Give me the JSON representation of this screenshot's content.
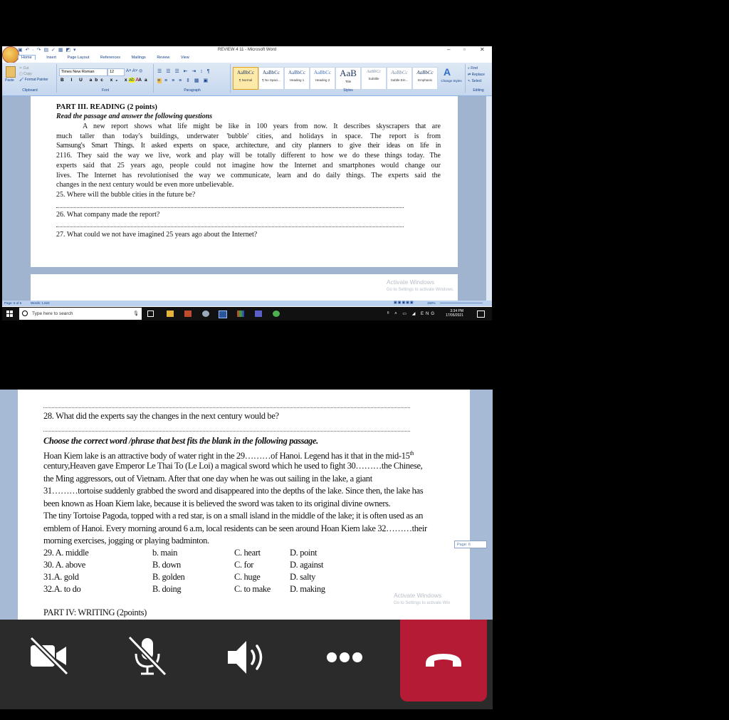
{
  "word_window": {
    "title": "REVIEW 4 11 - Microsoft Word",
    "tabs": [
      "Home",
      "Insert",
      "Page Layout",
      "References",
      "Mailings",
      "Review",
      "View"
    ],
    "clipboard": {
      "paste": "Paste",
      "cut": "Cut",
      "copy": "Copy",
      "format_painter": "Format Painter",
      "label": "Clipboard"
    },
    "font": {
      "name": "Times New Roman",
      "size": "12",
      "label": "Font"
    },
    "paragraph_label": "Paragraph",
    "styles": [
      {
        "sample": "AaBbCc",
        "name": "¶ Normal"
      },
      {
        "sample": "AaBbCc",
        "name": "¶ No Spaci..."
      },
      {
        "sample": "AaBbCc",
        "name": "Heading 1"
      },
      {
        "sample": "AaBbCc",
        "name": "Heading 2"
      },
      {
        "sample": "AaB",
        "name": "Title"
      },
      {
        "sample": "AaBbCc",
        "name": "Subtitle"
      },
      {
        "sample": "AaBbCc",
        "name": "Subtle Em..."
      },
      {
        "sample": "AaBbCc",
        "name": "Emphasis"
      }
    ],
    "styles_label": "Styles",
    "change_styles": "Change Styles",
    "editing": {
      "find": "Find",
      "replace": "Replace",
      "select": "Select",
      "label": "Editing"
    },
    "status": {
      "page": "Page: 5 of 6",
      "words": "Words: 1,622",
      "zoom": "150%"
    },
    "watermark": {
      "line1": "Activate Windows",
      "line2": "Go to Settings to activate Windows."
    }
  },
  "reading_section": {
    "heading": "PART III. READING (2 points)",
    "instruction": "Read the passage and answer the following questions",
    "passage_lines": [
      "A new report shows what life might be like in 100 years from now. It describes skyscrapers that are",
      "much taller than today's buildings, underwater 'bubble' cities, and holidays in space. The report is from",
      "Samsung's Smart Things. It asked experts on space, architecture, and city planners to give their ideas on life in",
      "2116. They said the way we live, work and play will be totally different to how we do these things today. The",
      "experts said that 25 years ago, people could not imagine how the Internet and smartphones would change our",
      "lives. The Internet has revolutionised the way we communicate, learn and do daily things. The experts said the",
      "changes in the next century would be even more unbelievable."
    ],
    "q25": "25. Where will the bubble cities in the future be?",
    "q26": "26. What company made the report?",
    "q27": "27. What could we not have imagined 25 years ago about the Internet?"
  },
  "taskbar": {
    "search_placeholder": "Type here to search",
    "language": "ENG",
    "time": "3:34 PM",
    "date": "17/05/2021"
  },
  "second_page": {
    "q28": "28. What did the experts say the changes in the next century would be?",
    "instruction": "Choose the correct word /phrase that best fits the blank in the following passage.",
    "passage_lines": [
      "Hoan Kiem lake is an attractive body of water right in the 29………of Hanoi. Legend has it that in the mid-15",
      "century,Heaven gave Emperor Le Thai To (Le Loi) a magical sword which he used to fight 30………the Chinese,",
      "the Ming aggressors, out of Vietnam. After that one day when he was out  sailing in the lake, a giant",
      "31………tortoise suddenly grabbed the sword and disappeared into the depths of the lake. Since then, the lake has",
      "been known as Hoan Kiem lake, because it is believed the sword was taken to its original divine owners.",
      "The tiny Tortoise Pagoda, topped with a red star, is on a small island in the middle of the lake; it is often used  as an",
      "emblem of Hanoi. Every morning around 6 a.m, local residents can be seen around Hoan Kiem lake 32………their",
      "morning exercises, jogging or playing badminton."
    ],
    "superscript": "th",
    "options": [
      [
        "29. A. middle",
        "b. main",
        "C. heart",
        "D. point"
      ],
      [
        "30. A. above",
        "B. down",
        "C. for",
        "D. against"
      ],
      [
        "31.A. gold",
        "B. golden",
        "C. huge",
        "D. salty"
      ],
      [
        "32.A. to do",
        "B. doing",
        "C. to make",
        "D. making"
      ]
    ],
    "next_heading": "PART IV: WRITING (2points)",
    "page_tag": "Page: 6",
    "watermark": {
      "line1": "Activate Windows",
      "line2": "Go to Settings to activate Win"
    }
  },
  "call_controls": {
    "camera": "camera-off",
    "mic": "mic-off",
    "speaker": "speaker-on",
    "more": "more",
    "hangup": "end-call",
    "hangup_color": "#b51b35"
  }
}
